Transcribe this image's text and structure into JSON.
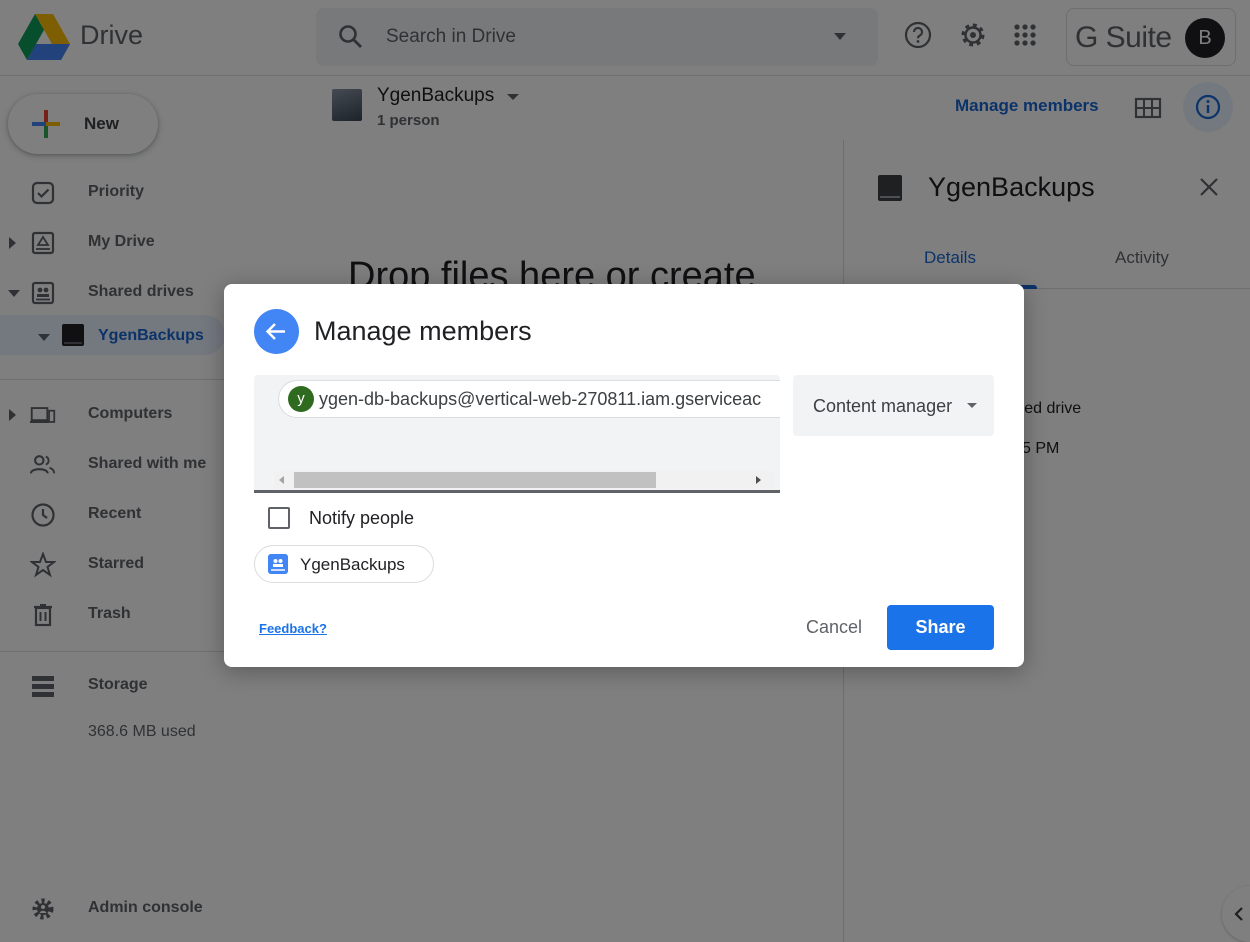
{
  "app": {
    "name": "Drive"
  },
  "search": {
    "placeholder": "Search in Drive"
  },
  "header": {
    "gsuite_label": "G Suite",
    "avatar_initial": "B"
  },
  "sidebar": {
    "new_label": "New",
    "items": [
      {
        "label": "Priority"
      },
      {
        "label": "My Drive"
      },
      {
        "label": "Shared drives"
      },
      {
        "label": "YgenBackups"
      },
      {
        "label": "Computers"
      },
      {
        "label": "Shared with me"
      },
      {
        "label": "Recent"
      },
      {
        "label": "Starred"
      },
      {
        "label": "Trash"
      },
      {
        "label": "Storage"
      },
      {
        "label": "Admin console"
      }
    ],
    "storage_used": "368.6 MB used"
  },
  "main": {
    "drive_name": "YgenBackups",
    "drive_members": "1 person",
    "drop_text": "Drop files here or create",
    "manage_members_link": "Manage members"
  },
  "details_panel": {
    "title": "YgenBackups",
    "tabs": [
      "Details",
      "Activity"
    ],
    "partial_type": "ared drive",
    "partial_time": "5 PM"
  },
  "dialog": {
    "title": "Manage members",
    "recipient_initial": "y",
    "recipient_email": "ygen-db-backups@vertical-web-270811.iam.gserviceac",
    "role": "Content manager",
    "notify_label": "Notify people",
    "drive_chip_label": "YgenBackups",
    "feedback_link": "Feedback?",
    "cancel_label": "Cancel",
    "share_label": "Share"
  },
  "colors": {
    "accent": "#1a73e8",
    "selected_bg": "#e8f0fe",
    "back_button": "#4285f4",
    "recipient_avatar": "#2e6b1f"
  }
}
